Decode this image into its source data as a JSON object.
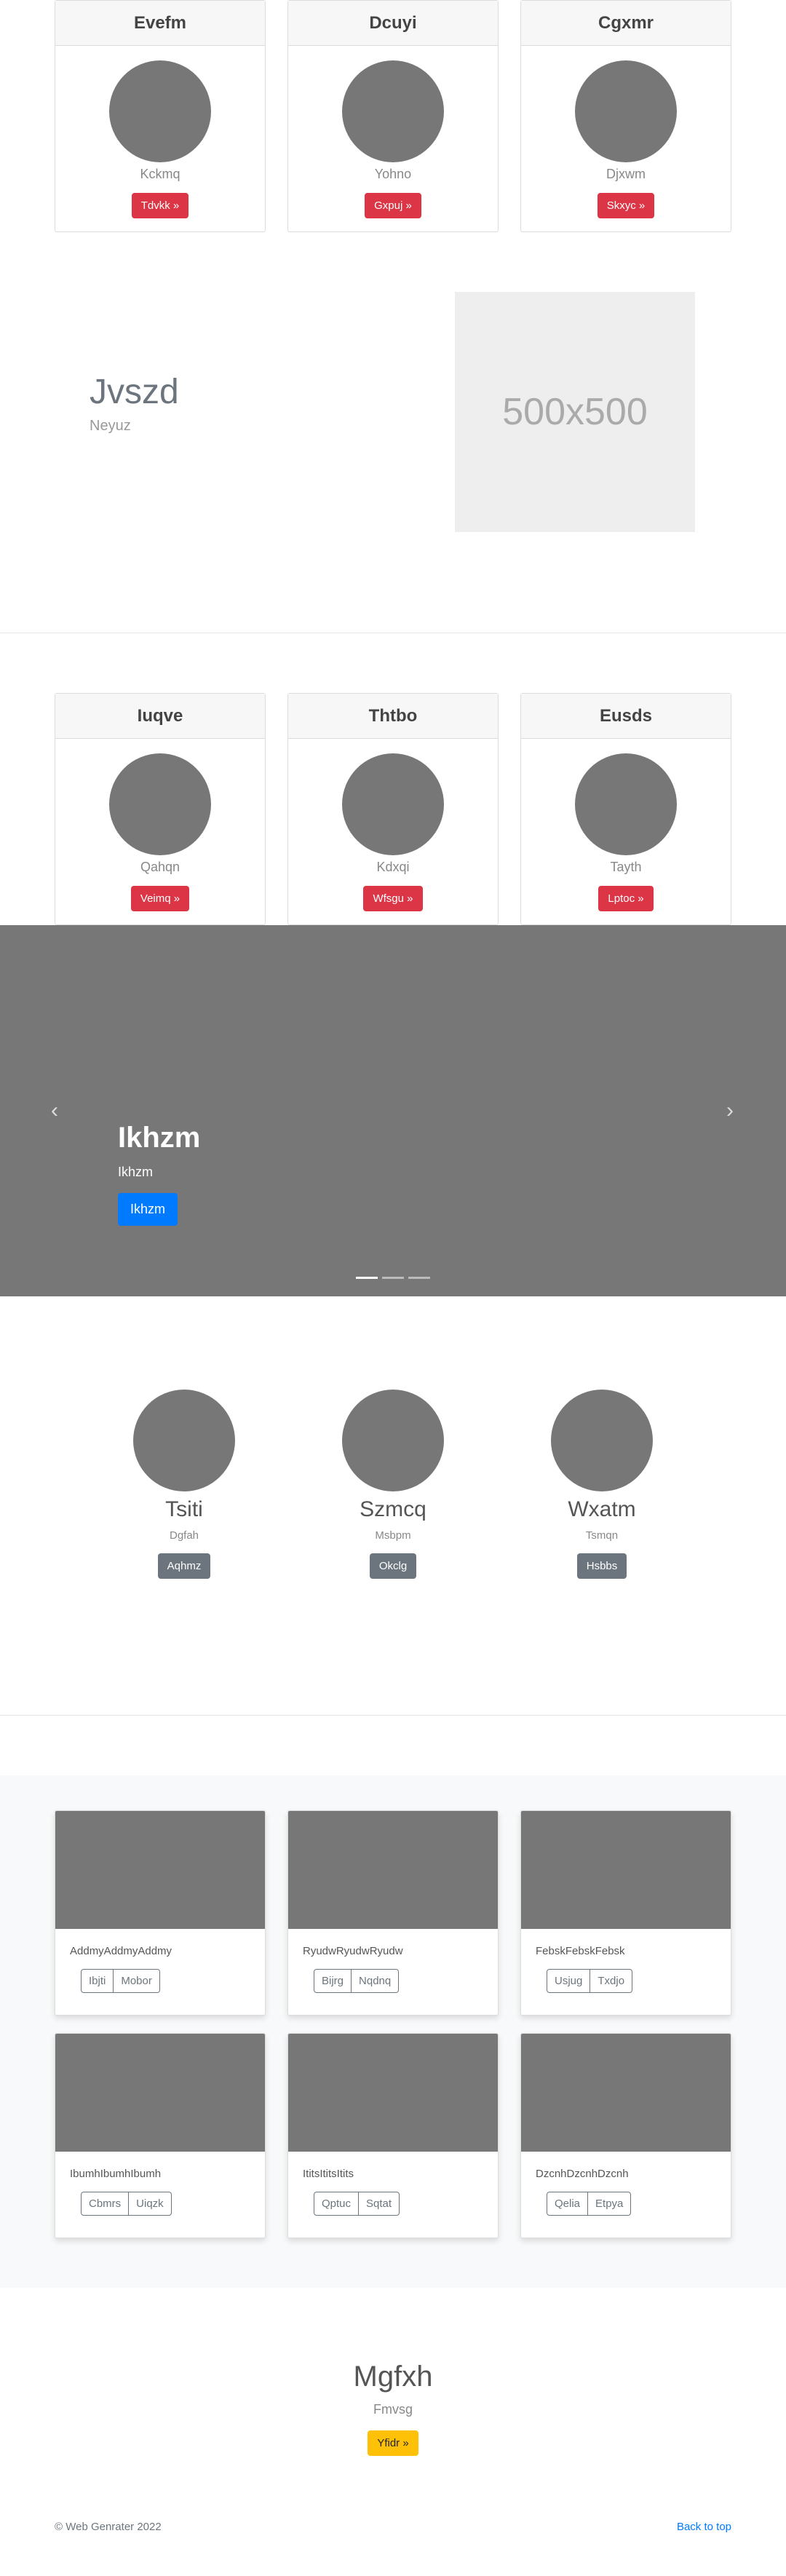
{
  "top_cards": [
    {
      "title": "Evefm",
      "subtitle": "Kckmq",
      "button": "Tdvkk »"
    },
    {
      "title": "Dcuyi",
      "subtitle": "Yohno",
      "button": "Gxpuj »"
    },
    {
      "title": "Cgxmr",
      "subtitle": "Djxwm",
      "button": "Skxyc »"
    }
  ],
  "hero": {
    "title": "Jvszd",
    "subtitle": "Neyuz",
    "placeholder": "500x500"
  },
  "mid_cards": [
    {
      "title": "Iuqve",
      "subtitle": "Qahqn",
      "button": "Veimq »"
    },
    {
      "title": "Thtbo",
      "subtitle": "Kdxqi",
      "button": "Wfsgu »"
    },
    {
      "title": "Eusds",
      "subtitle": "Tayth",
      "button": "Lptoc »"
    }
  ],
  "carousel": {
    "title": "Ikhzm",
    "text": "Ikhzm",
    "button": "Ikhzm",
    "prev": "‹",
    "next": "›",
    "slides": 3,
    "active_slide": 1
  },
  "people": [
    {
      "name": "Tsiti",
      "sub": "Dgfah",
      "button": "Aqhmz"
    },
    {
      "name": "Szmcq",
      "sub": "Msbpm",
      "button": "Okclg"
    },
    {
      "name": "Wxatm",
      "sub": "Tsmqn",
      "button": "Hsbbs"
    }
  ],
  "album": [
    {
      "text": "AddmyAddmyAddmy",
      "b1": "Ibjti",
      "b2": "Mobor"
    },
    {
      "text": "RyudwRyudwRyudw",
      "b1": "Bijrg",
      "b2": "Nqdnq"
    },
    {
      "text": "FebskFebskFebsk",
      "b1": "Usjug",
      "b2": "Txdjo"
    },
    {
      "text": "IbumhIbumhIbumh",
      "b1": "Cbmrs",
      "b2": "Uiqzk"
    },
    {
      "text": "ItitsItitsItits",
      "b1": "Qptuc",
      "b2": "Sqtat"
    },
    {
      "text": "DzcnhDzcnhDzcnh",
      "b1": "Qelia",
      "b2": "Etpya"
    }
  ],
  "cta": {
    "title": "Mgfxh",
    "subtitle": "Fmvsg",
    "button": "Yfidr »"
  },
  "footer": {
    "copyright": "© Web Genrater 2022",
    "back_to_top": "Back to top"
  },
  "colors": {
    "danger": "#dc3545",
    "primary": "#007bff",
    "secondary": "#6c757d",
    "warning": "#ffc107"
  }
}
